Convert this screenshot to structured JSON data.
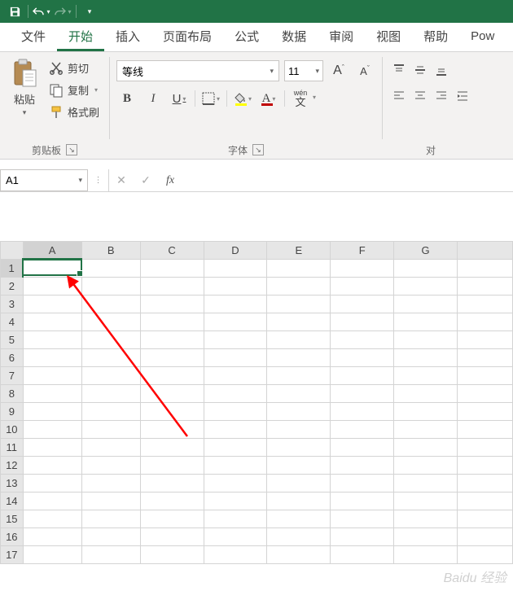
{
  "titlebar": {
    "save_icon": "save-icon",
    "undo_icon": "undo-icon",
    "redo_icon": "redo-icon"
  },
  "tabs": {
    "file": "文件",
    "home": "开始",
    "insert": "插入",
    "layout": "页面布局",
    "formulas": "公式",
    "data": "数据",
    "review": "审阅",
    "view": "视图",
    "help": "帮助",
    "power": "Pow"
  },
  "clipboard": {
    "paste": "粘贴",
    "cut": "剪切",
    "copy": "复制",
    "format_painter": "格式刷",
    "group_label": "剪贴板"
  },
  "font": {
    "name": "等线",
    "size": "11",
    "bold": "B",
    "italic": "I",
    "underline": "U",
    "phonetic": "wén",
    "group_label": "字体",
    "increase_label": "A",
    "decrease_label": "A",
    "font_color_hex": "#c00000",
    "fill_color_hex": "#ffff00"
  },
  "alignment": {
    "group_label": "对"
  },
  "namebox": {
    "value": "A1"
  },
  "fx": {
    "label": "fx"
  },
  "columns": [
    "A",
    "B",
    "C",
    "D",
    "E",
    "F",
    "G"
  ],
  "rows": [
    "1",
    "2",
    "3",
    "4",
    "5",
    "6",
    "7",
    "8",
    "9",
    "10",
    "11",
    "12",
    "13",
    "14",
    "15",
    "16",
    "17"
  ],
  "active_cell": {
    "col": 0,
    "row": 0
  },
  "watermark": "Baidu 经验"
}
